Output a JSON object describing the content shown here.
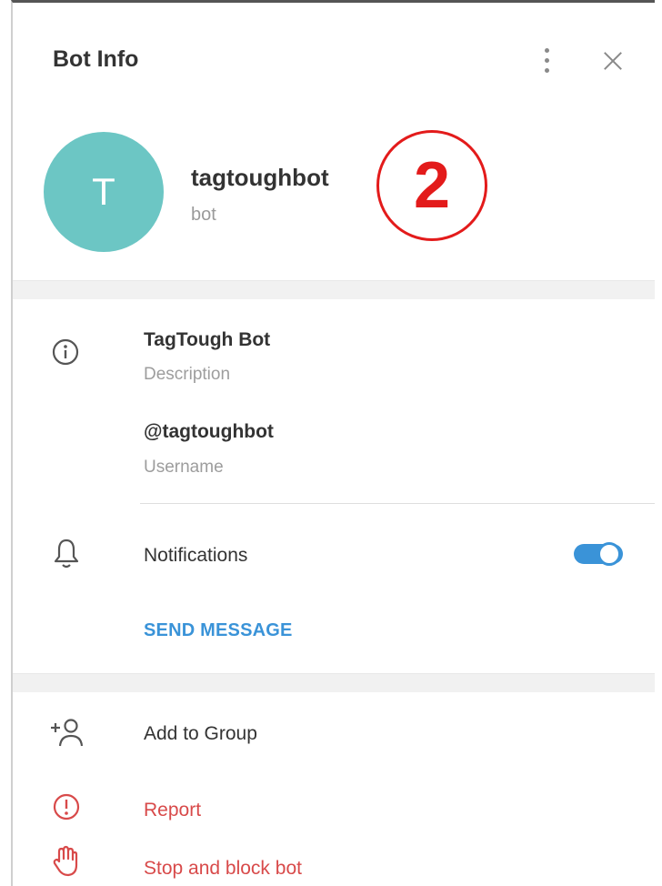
{
  "header": {
    "title": "Bot Info"
  },
  "profile": {
    "avatar_letter": "T",
    "name": "tagtoughbot",
    "subtitle": "bot"
  },
  "annotation": {
    "number": "2"
  },
  "info": {
    "description_value": "TagTough Bot",
    "description_label": "Description",
    "username_value": "@tagtoughbot",
    "username_label": "Username"
  },
  "notifications": {
    "label": "Notifications",
    "enabled": true
  },
  "send_message": {
    "label": "SEND MESSAGE"
  },
  "actions": {
    "add_to_group": "Add to Group",
    "report": "Report",
    "stop_block": "Stop and block bot"
  },
  "colors": {
    "avatar": "#6cc6c4",
    "accent": "#3a93d8",
    "danger": "#d84a4a",
    "annotation": "#e31b1b"
  }
}
